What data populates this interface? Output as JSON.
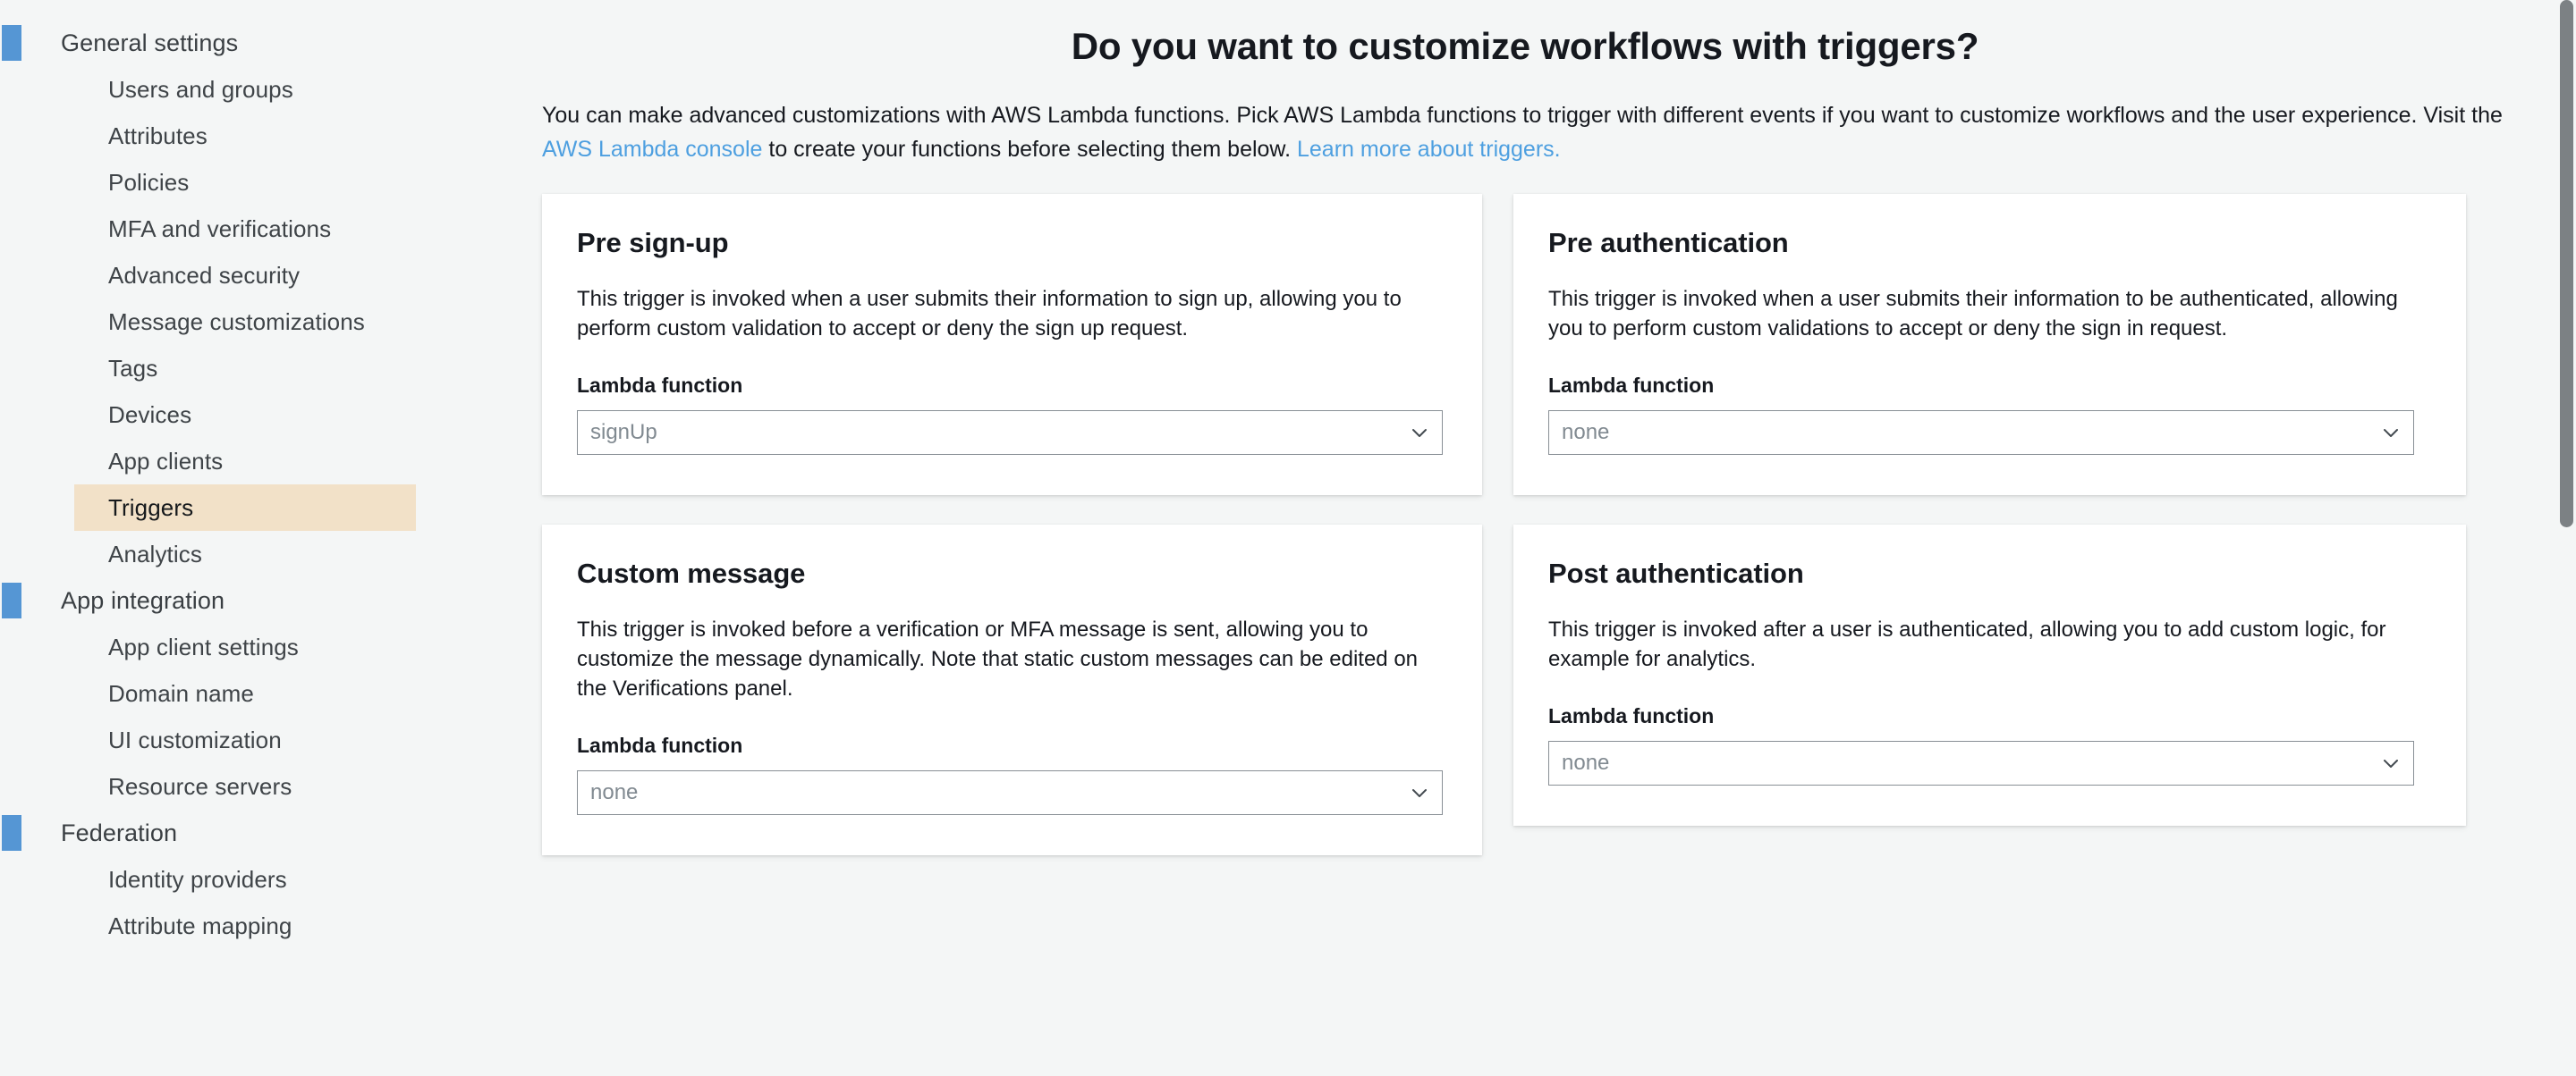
{
  "sidebar": {
    "groups": [
      {
        "label": "General settings",
        "items": [
          {
            "label": "Users and groups",
            "selected": false
          },
          {
            "label": "Attributes",
            "selected": false
          },
          {
            "label": "Policies",
            "selected": false
          },
          {
            "label": "MFA and verifications",
            "selected": false
          },
          {
            "label": "Advanced security",
            "selected": false
          },
          {
            "label": "Message customizations",
            "selected": false
          },
          {
            "label": "Tags",
            "selected": false
          },
          {
            "label": "Devices",
            "selected": false
          },
          {
            "label": "App clients",
            "selected": false
          },
          {
            "label": "Triggers",
            "selected": true
          },
          {
            "label": "Analytics",
            "selected": false
          }
        ]
      },
      {
        "label": "App integration",
        "items": [
          {
            "label": "App client settings",
            "selected": false
          },
          {
            "label": "Domain name",
            "selected": false
          },
          {
            "label": "UI customization",
            "selected": false
          },
          {
            "label": "Resource servers",
            "selected": false
          }
        ]
      },
      {
        "label": "Federation",
        "items": [
          {
            "label": "Identity providers",
            "selected": false
          },
          {
            "label": "Attribute mapping",
            "selected": false
          }
        ]
      }
    ],
    "accent_color": "#5596d4",
    "selected_highlight_color": "#f2e1c8"
  },
  "main": {
    "title": "Do you want to customize workflows with triggers?",
    "intro": {
      "part1": "You can make advanced customizations with AWS Lambda functions. Pick AWS Lambda functions to trigger with different events if you want to customize workflows and the user experience. Visit the ",
      "link1": "AWS Lambda console",
      "part2": " to create your functions before selecting them below. ",
      "link2": "Learn more about triggers.",
      "link_color": "#4d9fe0"
    },
    "field_label": "Lambda function",
    "chevron_icon": "chevron-down-icon",
    "cards": [
      {
        "title": "Pre sign-up",
        "description": "This trigger is invoked when a user submits their information to sign up, allowing you to perform custom validation to accept or deny the sign up request.",
        "field_label": "Lambda function",
        "select_value": "signUp"
      },
      {
        "title": "Pre authentication",
        "description": "This trigger is invoked when a user submits their information to be authenticated, allowing you to perform custom validations to accept or deny the sign in request.",
        "field_label": "Lambda function",
        "select_value": "none"
      },
      {
        "title": "Custom message",
        "description": "This trigger is invoked before a verification or MFA message is sent, allowing you to customize the message dynamically. Note that static custom messages can be edited on the Verifications panel.",
        "field_label": "Lambda function",
        "select_value": "none"
      },
      {
        "title": "Post authentication",
        "description": "This trigger is invoked after a user is authenticated, allowing you to add custom logic, for example for analytics.",
        "field_label": "Lambda function",
        "select_value": "none"
      }
    ]
  }
}
